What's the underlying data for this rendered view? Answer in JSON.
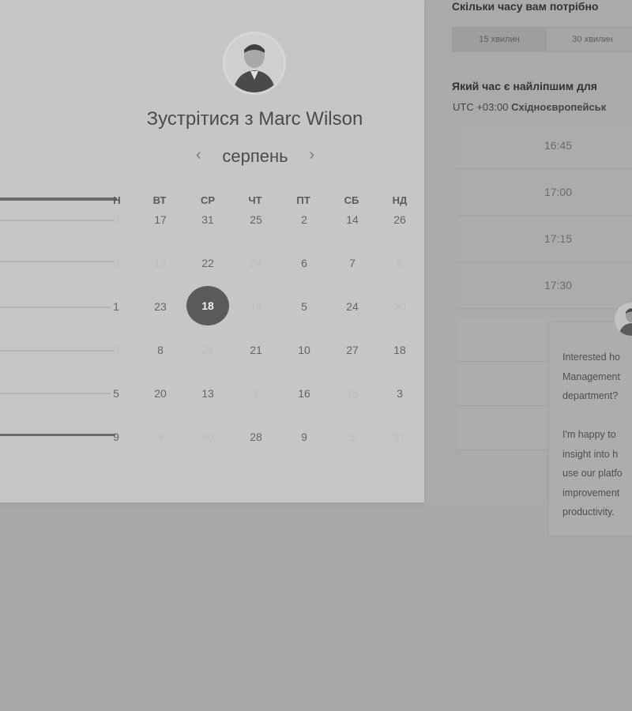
{
  "scheduler": {
    "title": "Зустрітися з Marc Wilson",
    "month": "серпень",
    "weekdays": [
      "ВТ",
      "СР",
      "ЧТ",
      "ПТ",
      "СБ",
      "НД"
    ],
    "truncated_weekday": "Н",
    "left_column_days": [
      "0",
      "9",
      "1",
      "0",
      "5",
      "9"
    ],
    "weeks": [
      [
        "17",
        "31",
        "25",
        "2",
        "14",
        "26"
      ],
      [
        "13",
        "22",
        "24",
        "6",
        "7",
        "6"
      ],
      [
        "23",
        "18",
        "14",
        "5",
        "24",
        "30"
      ],
      [
        "8",
        "21",
        "21",
        "10",
        "27",
        "18"
      ],
      [
        "20",
        "13",
        "1",
        "16",
        "15",
        "3"
      ],
      [
        "9",
        "30",
        "28",
        "9",
        "5",
        "27"
      ]
    ],
    "selected_day": "18"
  },
  "booking": {
    "duration_question": "Скільки часу вам потрібно",
    "durations": [
      "15 хвилин",
      "30 хвилин"
    ],
    "time_question": "Який час є найліпшим для",
    "timezone_offset": "UTC +03:00",
    "timezone_name": "Східноєвропейськ",
    "slots": [
      "16:45",
      "17:00",
      "17:15",
      "17:30"
    ]
  },
  "chat": {
    "lines": [
      "Interested ho",
      "Management",
      "department?",
      "",
      "I'm happy to",
      "insight into h",
      "use our platfo",
      "improvement",
      "productivity."
    ]
  },
  "colors": {
    "overlay_bg": "#a9a9a9",
    "selected_day_bg": "#5b5b5b"
  }
}
